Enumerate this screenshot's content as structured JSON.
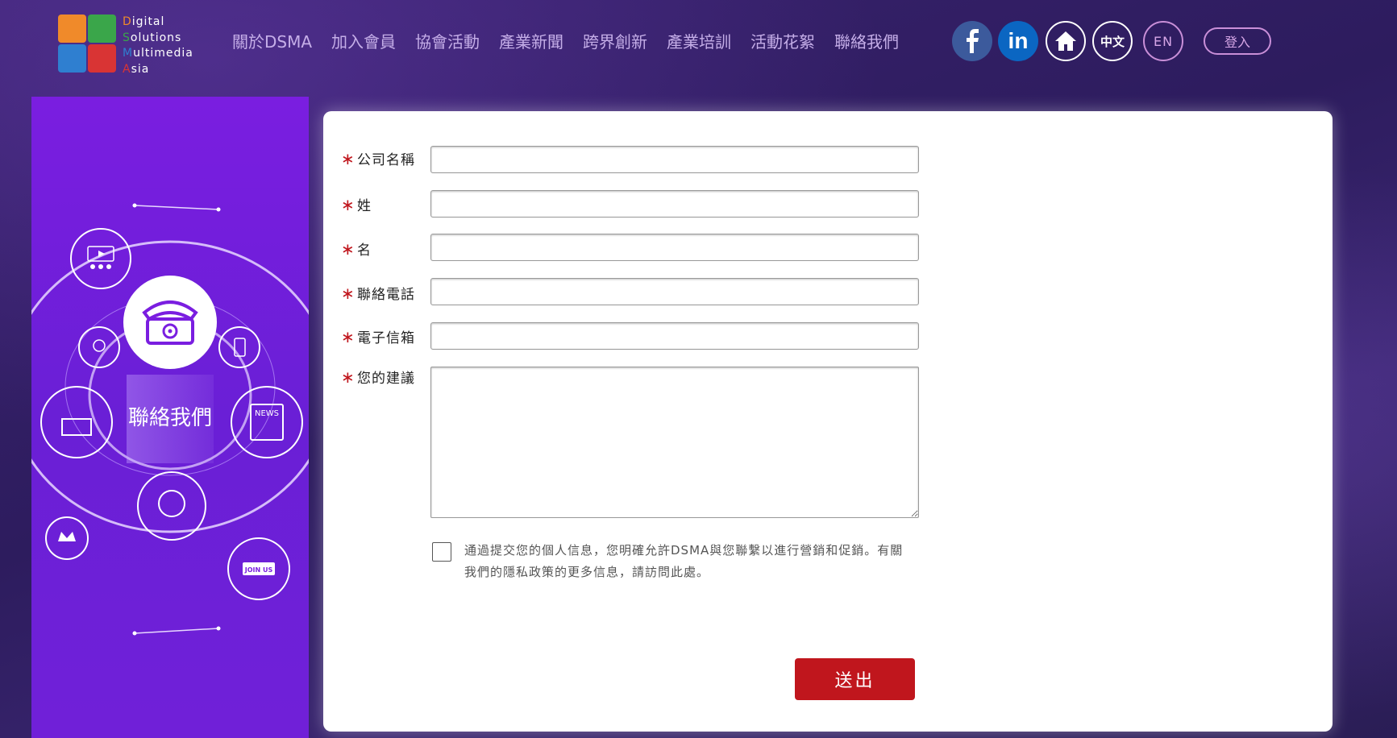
{
  "logo": {
    "lines": [
      {
        "initial": "D",
        "rest": "igital",
        "color": "#f08a2a"
      },
      {
        "initial": "S",
        "rest": "olutions",
        "color": "#3aa64a"
      },
      {
        "initial": "M",
        "rest": "ultimedia",
        "color": "#2f7fd0"
      },
      {
        "initial": "A",
        "rest": "sia",
        "color": "#d93434"
      }
    ],
    "tile_colors": [
      "#f08a2a",
      "#3aa64a",
      "#2f7fd0",
      "#d93434"
    ]
  },
  "nav": {
    "items": [
      "關於DSMA",
      "加入會員",
      "協會活動",
      "產業新聞",
      "跨界創新",
      "產業培訓",
      "活動花絮",
      "聯絡我們"
    ]
  },
  "header_buttons": {
    "facebook_icon": "facebook-icon",
    "linkedin_icon": "linkedin-icon",
    "linkedin_text": "in",
    "home_icon": "home-icon",
    "lang_zh": "中文",
    "lang_en": "EN",
    "login": "登入"
  },
  "left_panel": {
    "title": "聯絡我們",
    "badge_text": "JOIN US",
    "news_text": "NEWS"
  },
  "form": {
    "required_mark": "∗",
    "fields": [
      {
        "label": "公司名稱",
        "value": ""
      },
      {
        "label": "姓",
        "value": ""
      },
      {
        "label": "名",
        "value": ""
      },
      {
        "label": "聯絡電話",
        "value": ""
      },
      {
        "label": "電子信箱",
        "value": ""
      },
      {
        "label": "您的建議",
        "value": ""
      }
    ],
    "consent_text": "通過提交您的個人信息，您明確允許DSMA與您聯繫以進行營銷和促銷。有關我們的隱私政策的更多信息，請訪問此處。",
    "submit": "送出"
  },
  "colors": {
    "accent_red": "#c0161d",
    "panel_purple": "#7a1ee0",
    "nav_text": "#c5aee8"
  }
}
